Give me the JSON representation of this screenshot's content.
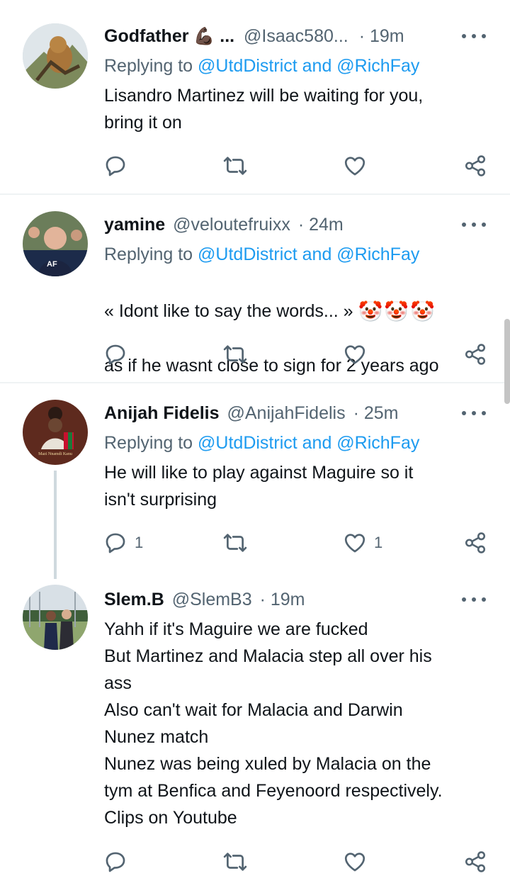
{
  "tweets": [
    {
      "name": "Godfather",
      "name_emoji": "💪🏿",
      "name_suffix": "...",
      "handle": "@Isaac580...",
      "time": "· 19m",
      "reply_prefix": "Replying to ",
      "reply_mentions": "@UtdDistrict and @RichFay",
      "text": "Lisandro Martinez will be waiting for you,\nbring it on",
      "reply_count": "",
      "retweet_count": "",
      "like_count": ""
    },
    {
      "name": "yamine",
      "handle": "@veloutefruixx",
      "time": "· 24m",
      "reply_prefix": "Replying to ",
      "reply_mentions": "@UtdDistrict and @RichFay",
      "text_line1": "« Idont like to say the words... »",
      "text_line1_emojis": "🤡🤡🤡",
      "text_line2": "as if he wasnt close to sign for 2 years ago",
      "reply_count": "",
      "retweet_count": "",
      "like_count": ""
    },
    {
      "name": "Anijah Fidelis",
      "handle": "@AnijahFidelis",
      "time": "· 25m",
      "reply_prefix": "Replying to ",
      "reply_mentions": "@UtdDistrict and @RichFay",
      "text": "He will like to play against Maguire so it\nisn't surprising",
      "reply_count": "1",
      "retweet_count": "",
      "like_count": "1",
      "avatar_caption": "Mazi Nnamdi Kanu"
    },
    {
      "name": "Slem.B",
      "handle": "@SlemB3",
      "time": "· 19m",
      "text": "Yahh if it's Maguire we are fucked\nBut Martinez and Malacia step all over his\nass\nAlso can't wait for Malacia and Darwin\nNunez match\nNunez was being xuled by Malacia on the\ntym at Benfica and Feyenoord respectively.\nClips on Youtube",
      "reply_count": "",
      "retweet_count": "",
      "like_count": ""
    }
  ],
  "icons": {
    "reply": "reply-icon",
    "retweet": "retweet-icon",
    "like": "heart-icon",
    "share": "share-icon",
    "more": "more-icon"
  },
  "colors": {
    "text": "#0f1419",
    "secondary": "#536471",
    "link": "#1d9bf0",
    "divider": "#eff3f4"
  }
}
